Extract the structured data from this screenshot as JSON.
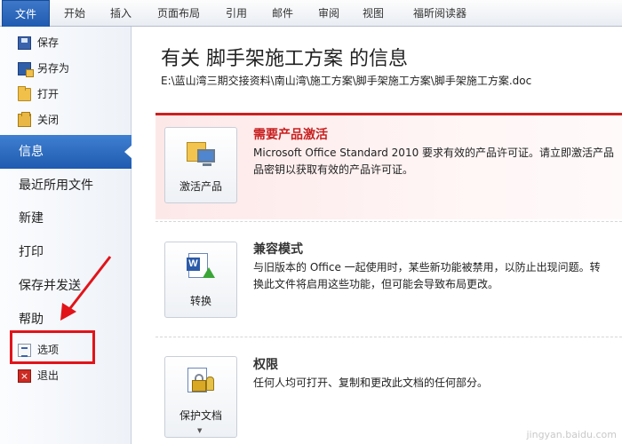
{
  "ribbon": {
    "tabs": [
      "文件",
      "开始",
      "插入",
      "页面布局",
      "引用",
      "邮件",
      "审阅",
      "视图",
      "福昕阅读器"
    ]
  },
  "sidebar": {
    "commands": [
      {
        "label": "保存",
        "icon": "save-icon"
      },
      {
        "label": "另存为",
        "icon": "save-as-icon"
      },
      {
        "label": "打开",
        "icon": "open-folder-icon"
      },
      {
        "label": "关闭",
        "icon": "close-folder-icon"
      }
    ],
    "nav": [
      {
        "label": "信息",
        "active": true
      },
      {
        "label": "最近所用文件"
      },
      {
        "label": "新建"
      },
      {
        "label": "打印"
      },
      {
        "label": "保存并发送"
      },
      {
        "label": "帮助"
      }
    ],
    "bottom": [
      {
        "label": "选项",
        "icon": "options-icon"
      },
      {
        "label": "退出",
        "icon": "exit-icon"
      }
    ]
  },
  "main": {
    "title": "有关 脚手架施工方案 的信息",
    "path": "E:\\蓝山湾三期交接资料\\南山湾\\施工方案\\脚手架施工方案\\脚手架施工方案.doc",
    "sections": [
      {
        "button": "激活产品",
        "heading": "需要产品激活",
        "lines": [
          "Microsoft Office Standard 2010 要求有效的产品许可证。请立即激活产品",
          "品密钥以获取有效的产品许可证。"
        ]
      },
      {
        "button": "转换",
        "heading": "兼容模式",
        "lines": [
          "与旧版本的 Office 一起使用时，某些新功能被禁用，以防止出现问题。转",
          "换此文件将启用这些功能，但可能会导致布局更改。"
        ]
      },
      {
        "button": "保护文档",
        "heading": "权限",
        "lines": [
          "任何人均可打开、复制和更改此文档的任何部分。"
        ]
      }
    ]
  },
  "watermark": "jingyan.baidu.com",
  "colors": {
    "accent": "#1f5bb0",
    "alert": "#c82020",
    "highlight": "#e1141a"
  }
}
